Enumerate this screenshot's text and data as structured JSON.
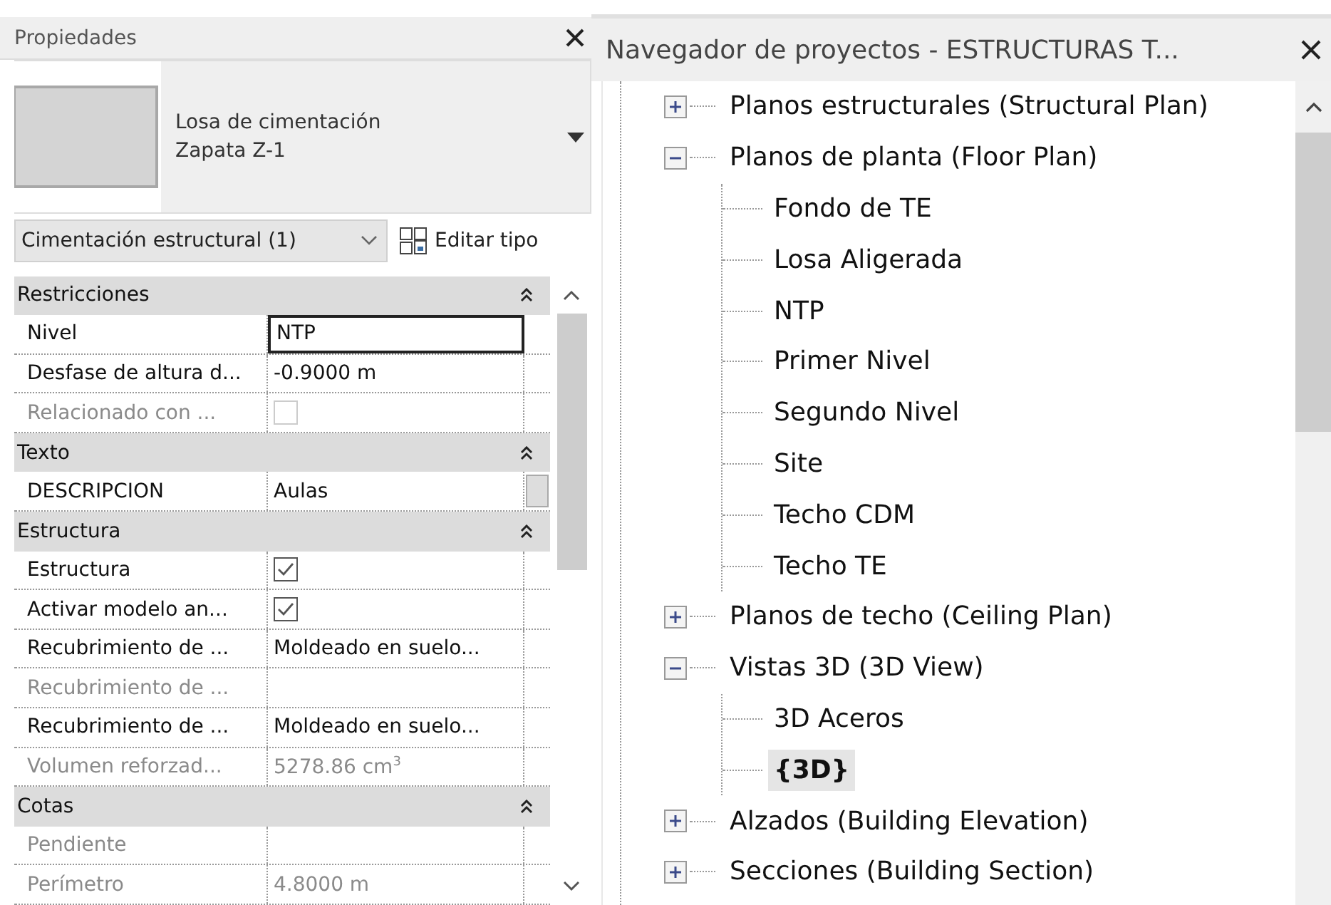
{
  "properties": {
    "title": "Propiedades",
    "type_selector": {
      "family": "Losa de cimentación",
      "type": "Zapata Z-1"
    },
    "filter": {
      "value": "Cimentación estructural (1)"
    },
    "edit_type_button": "Editar tipo",
    "rows": [
      {
        "kind": "group",
        "label": "Restricciones",
        "expanded": true
      },
      {
        "kind": "field",
        "label": "Nivel",
        "value": "NTP",
        "disabled": false
      },
      {
        "kind": "text",
        "label": "Desfase de altura d...",
        "value": "-0.9000 m",
        "disabled": false
      },
      {
        "kind": "checkbox",
        "label": "Relacionado con ...",
        "checked": false,
        "disabled": true
      },
      {
        "kind": "group",
        "label": "Texto",
        "expanded": true
      },
      {
        "kind": "button",
        "label": "DESCRIPCION",
        "value": "Aulas",
        "disabled": false
      },
      {
        "kind": "group",
        "label": "Estructura",
        "expanded": true
      },
      {
        "kind": "checkbox",
        "label": "Estructura",
        "checked": true,
        "disabled": false
      },
      {
        "kind": "checkbox",
        "label": "Activar modelo an...",
        "checked": true,
        "disabled": false
      },
      {
        "kind": "text",
        "label": "Recubrimiento de ...",
        "value": "Moldeado en suelo...",
        "disabled": false
      },
      {
        "kind": "text",
        "label": "Recubrimiento de ...",
        "disabled": true
      },
      {
        "kind": "text",
        "label": "Recubrimiento de ...",
        "value": "Moldeado en suelo...",
        "disabled": false
      },
      {
        "kind": "text",
        "label": "Volumen reforzad...",
        "value": "5278.86 cm$^{3}$",
        "disabled": true
      },
      {
        "kind": "group",
        "label": "Cotas",
        "expanded": true
      },
      {
        "kind": "text",
        "label": "Pendiente",
        "disabled": true
      },
      {
        "kind": "text",
        "label": "Perímetro",
        "value": "4.8000 m",
        "disabled": true
      }
    ]
  },
  "browser": {
    "title": "Navegador de proyectos - ESTRUCTURAS T...",
    "tree": [
      {
        "label": "Planos estructurales (Structural Plan)",
        "expanded": false
      },
      {
        "label": "Planos de planta (Floor Plan)",
        "expanded": true,
        "children": [
          {
            "label": "Fondo de TE",
            "selected": false
          },
          {
            "label": "Losa Aligerada",
            "selected": false
          },
          {
            "label": "NTP",
            "selected": false
          },
          {
            "label": "Primer Nivel",
            "selected": false
          },
          {
            "label": "Segundo Nivel",
            "selected": false
          },
          {
            "label": "Site",
            "selected": false
          },
          {
            "label": "Techo CDM",
            "selected": false
          },
          {
            "label": "Techo TE",
            "selected": false
          }
        ]
      },
      {
        "label": "Planos de techo (Ceiling Plan)",
        "expanded": false
      },
      {
        "label": "Vistas 3D (3D View)",
        "expanded": true,
        "children": [
          {
            "label": "3D Aceros",
            "selected": false
          },
          {
            "label": "{3D}",
            "selected": true
          }
        ]
      },
      {
        "label": "Alzados (Building Elevation)",
        "expanded": false
      },
      {
        "label": "Secciones (Building Section)",
        "expanded": false
      }
    ]
  }
}
